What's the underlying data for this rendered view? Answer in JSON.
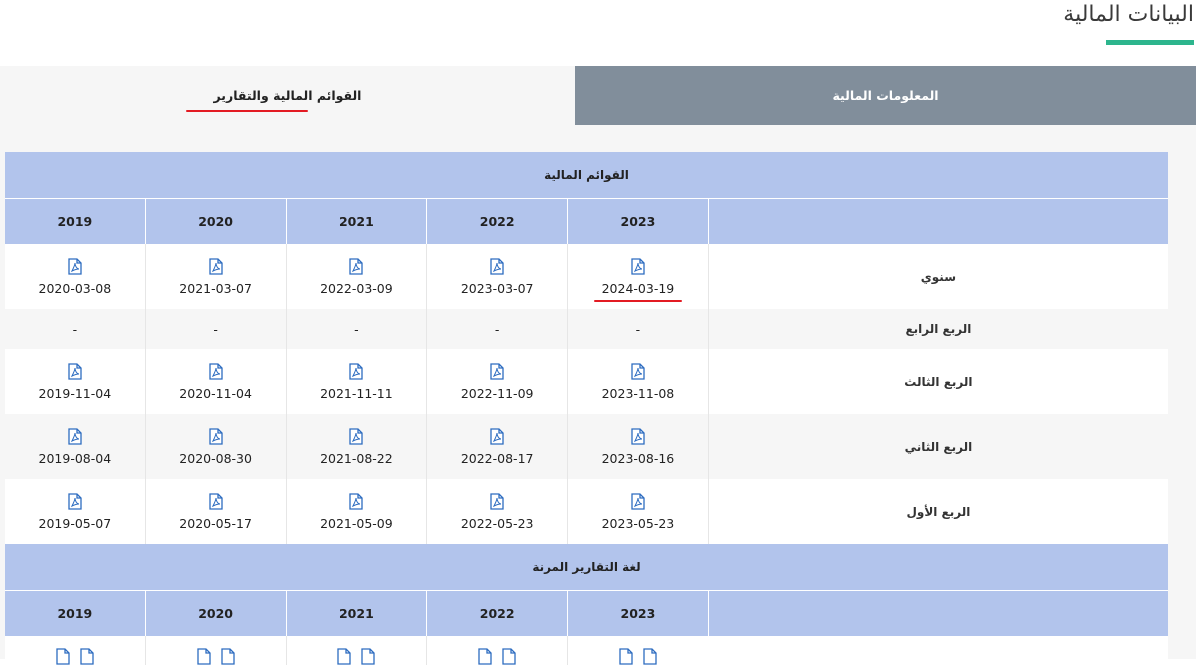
{
  "page": {
    "title": "البيانات المالية"
  },
  "tabs": {
    "reports": "القوائم المالية والتقارير",
    "info": "المعلومات المالية"
  },
  "colors": {
    "accent": "#2db58d",
    "tab_inactive": "#818e9b",
    "table_header": "#b2c4ec",
    "annotation": "#e31b23"
  },
  "financial_statements": {
    "title": "القوائم المالية",
    "years": [
      "2023",
      "2022",
      "2021",
      "2020",
      "2019"
    ],
    "rows": [
      {
        "label": "سنوي",
        "values": [
          "2024-03-19",
          "2023-03-07",
          "2022-03-09",
          "2021-03-07",
          "2020-03-08"
        ],
        "has_pdf": true
      },
      {
        "label": "الربع الرابع",
        "values": [
          "-",
          "-",
          "-",
          "-",
          "-"
        ],
        "has_pdf": false
      },
      {
        "label": "الربع الثالث",
        "values": [
          "2023-11-08",
          "2022-11-09",
          "2021-11-11",
          "2020-11-04",
          "2019-11-04"
        ],
        "has_pdf": true
      },
      {
        "label": "الربع الثاني",
        "values": [
          "2023-08-16",
          "2022-08-17",
          "2021-08-22",
          "2020-08-30",
          "2019-08-04"
        ],
        "has_pdf": true
      },
      {
        "label": "الربع الأول",
        "values": [
          "2023-05-23",
          "2022-05-23",
          "2021-05-09",
          "2020-05-17",
          "2019-05-07"
        ],
        "has_pdf": true
      }
    ]
  },
  "xbrl": {
    "title": "لغة التقارير المرنة",
    "years": [
      "2023",
      "2022",
      "2021",
      "2020",
      "2019"
    ]
  },
  "icons": {
    "document": "pdf-icon"
  }
}
